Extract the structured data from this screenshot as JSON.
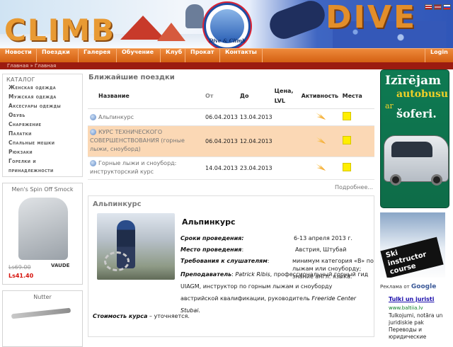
{
  "header": {
    "left_brand": "CLIMB",
    "right_brand": "DIVE",
    "logo_text": "Dive & Climb",
    "languages": [
      "en",
      "lv",
      "ru"
    ]
  },
  "nav": {
    "items": [
      "Новости",
      "Поездки",
      "Галерея",
      "Обучение",
      "Клуб",
      "Прокат",
      "Контакты"
    ],
    "login": "Login"
  },
  "breadcrumb": "Главная » Главная",
  "sidebar": {
    "catalog_title": "Каталог",
    "categories": [
      "Женская одежда",
      "Мужская одежда",
      "Аксесуары одежды",
      "Обувь",
      "Снаряжение",
      "Палатки",
      "Спальные мешки",
      "Рюкзаки",
      "Горелки и",
      "принадлежности"
    ],
    "product1": {
      "title": "Men's Spin Off Smock",
      "brand": "VAUDE",
      "old_price": "Ls69.00",
      "new_price": "Ls41.40"
    },
    "product2": {
      "title": "Nutter"
    }
  },
  "trips": {
    "title": "Ближайшие поездки",
    "columns": [
      "Название",
      "От",
      "До",
      "Цена, LVL",
      "Активность",
      "Места"
    ],
    "rows": [
      {
        "name": "Альпинкурс",
        "from": "06.04.2013",
        "to": "13.04.2013",
        "price": ""
      },
      {
        "name": "КУРС ТЕХНИЧЕСКОГО СОВЕРШЕНСТВОВАНИЯ (горные лыжи, сноуборд)",
        "from": "06.04.2013",
        "to": "12.04.2013",
        "price": ""
      },
      {
        "name": "Горные лыжи и сноуборд: инструкторский курс",
        "from": "14.04.2013",
        "to": "23.04.2013",
        "price": ""
      }
    ],
    "more": "Подробнее..."
  },
  "article": {
    "section": "Альпинкурс",
    "heading": "Альпинкурс",
    "dates_label": "Сроки проведения:",
    "dates_value": "6-13 апреля 2013 г.",
    "place_label": "Место проведения",
    "place_value": "Австрия, Штубай",
    "req_label": "Требования к слушателям",
    "req_value": "минимум категория «B» по лыжам или сноуборду; знание англ. языка.",
    "teacher_label": "Преподаватель",
    "teacher_name": "Patrick Ribis",
    "teacher_value": ", профессиональный горный гид UIAGM, инструктор по горным лыжам и сноуборду австрийской квалификации, руководитель",
    "teacher_org": "Freeride Center Stubai.",
    "cost_label": "Стоимость курса",
    "cost_value": " – уточняется."
  },
  "right": {
    "ad_line1": "Izīrējam",
    "ad_line2": "autobusu",
    "ad_line3": "ar",
    "ad_line4": "šoferi.",
    "ski_text": "Ski instructor course",
    "google_label": "Реклама от",
    "google_brand": "Google",
    "ad_title": "Tulki un juristi",
    "ad_url": "www.baltiia.lv",
    "ad_text": "Tulkojumi, notāra un juridiskie pak Переводы и юридические"
  },
  "colors": {
    "nav_orange": "#e37526",
    "crumb_red": "#9b1b10",
    "highlight": "#fbd8b5",
    "status_yellow": "#ffee00"
  }
}
